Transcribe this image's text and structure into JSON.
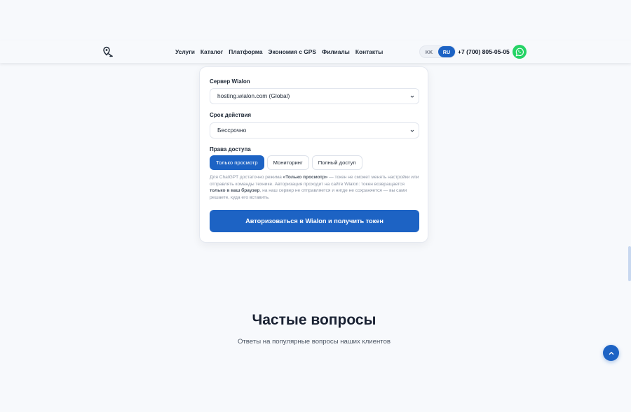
{
  "header": {
    "nav": [
      "Услуги",
      "Каталог",
      "Платформа",
      "Экономия с GPS",
      "Филиалы",
      "Контакты"
    ],
    "lang": {
      "kk": "KK",
      "ru": "RU",
      "active": "RU"
    },
    "phone": "+7 (700) 805-05-05",
    "logo_icon": "map-pin-icon",
    "whatsapp_icon": "whatsapp-icon"
  },
  "form": {
    "server_label": "Сервер Wialon",
    "server_value": "hosting.wialon.com (Global)",
    "period_label": "Срок действия",
    "period_value": "Бессрочно",
    "rights_label": "Права доступа",
    "rights": [
      "Только просмотр",
      "Мониторинг",
      "Полный доступ"
    ],
    "rights_selected": "Только просмотр",
    "note_p1": "Для ChatGPT достаточно режима ",
    "note_b1": "«Только просмотр»",
    "note_p2": " — токен не сможет менять настройки или отправлять команды технике. Авторизация проходит на сайте Wialon: токен возвращается ",
    "note_b2": "только в ваш браузер",
    "note_p3": ", на наш сервер не отправляется и нигде не сохраняется — вы сами решаете, куда его вставить.",
    "submit_label": "Авторизоваться в Wialon и получить токен"
  },
  "faq": {
    "title": "Частые вопросы",
    "subtitle": "Ответы на популярные вопросы наших клиентов"
  },
  "colors": {
    "accent": "#1d63c4",
    "whatsapp": "#25d366",
    "background": "#f7f9fc"
  }
}
